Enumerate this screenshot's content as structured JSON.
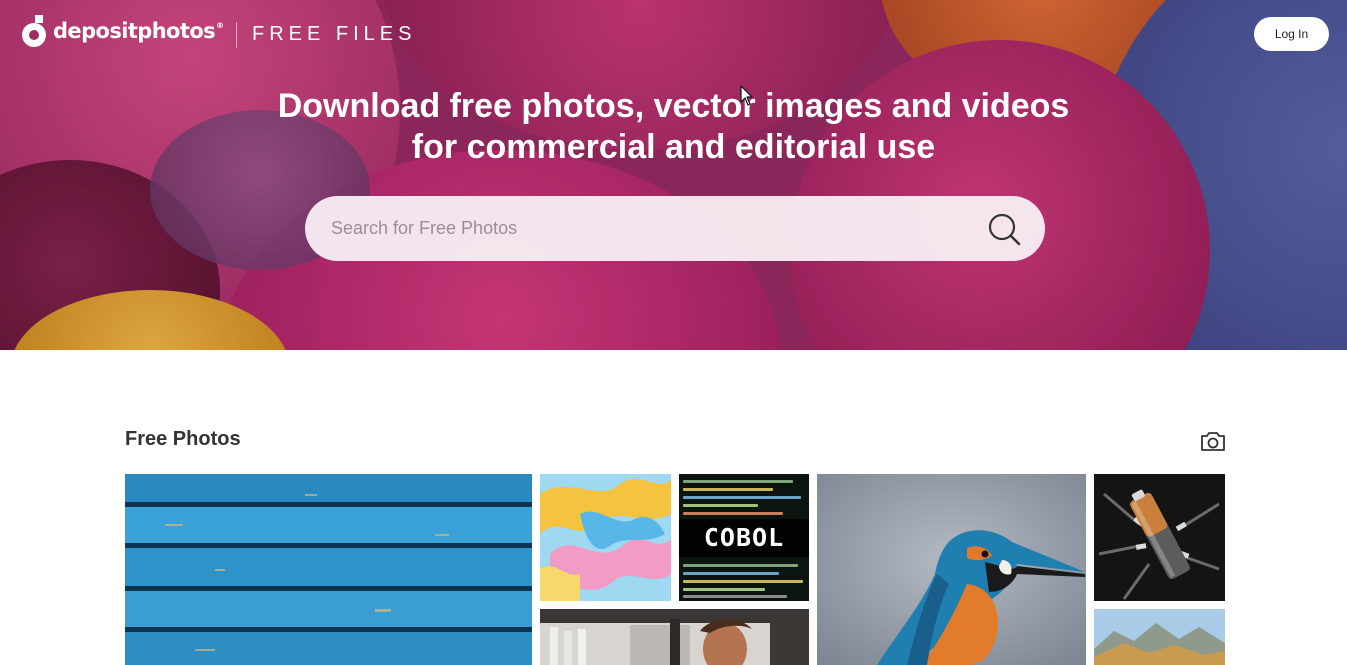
{
  "brand": {
    "name": "depositphotos",
    "registered": "®",
    "section": "FREE FILES"
  },
  "header": {
    "login_label": "Log In"
  },
  "hero": {
    "headline_line1": "Download free photos, vector images and videos",
    "headline_line2": "for commercial and editorial use"
  },
  "search": {
    "placeholder": "Search for Free Photos",
    "value": ""
  },
  "photos_section": {
    "title": "Free Photos",
    "tiles": [
      {
        "subject": "blue-wooden-planks"
      },
      {
        "subject": "colorful-fluid-art"
      },
      {
        "subject": "cobol-code",
        "caption": "COBOL"
      },
      {
        "subject": "kitchen-man"
      },
      {
        "subject": "kingfisher-bird"
      },
      {
        "subject": "battery-cables"
      },
      {
        "subject": "mountain-landscape"
      }
    ]
  },
  "icons": {
    "logo": "depositphotos-logo-icon",
    "search": "search-icon",
    "camera": "camera-icon",
    "cursor": "mouse-cursor-icon"
  },
  "colors": {
    "hero_base": "#8e2a5e",
    "search_bg": "#f8ecf2",
    "accent_blue": "#2a8fc4"
  }
}
